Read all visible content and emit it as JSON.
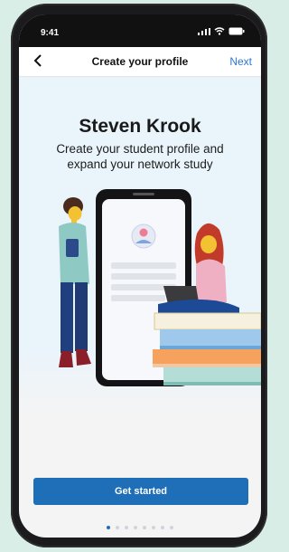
{
  "status": {
    "time": "9:41",
    "icons": [
      "signal-icon",
      "wifi-icon",
      "battery-icon"
    ]
  },
  "nav": {
    "title": "Create your profile",
    "next_label": "Next"
  },
  "hero": {
    "name": "Steven Krook",
    "subtitle": "Create your student profile and expand your network study"
  },
  "cta": {
    "label": "Get started"
  },
  "pagination": {
    "total": 8,
    "active_index": 0
  },
  "colors": {
    "accent": "#1f6fb8",
    "next": "#2a78d0"
  }
}
